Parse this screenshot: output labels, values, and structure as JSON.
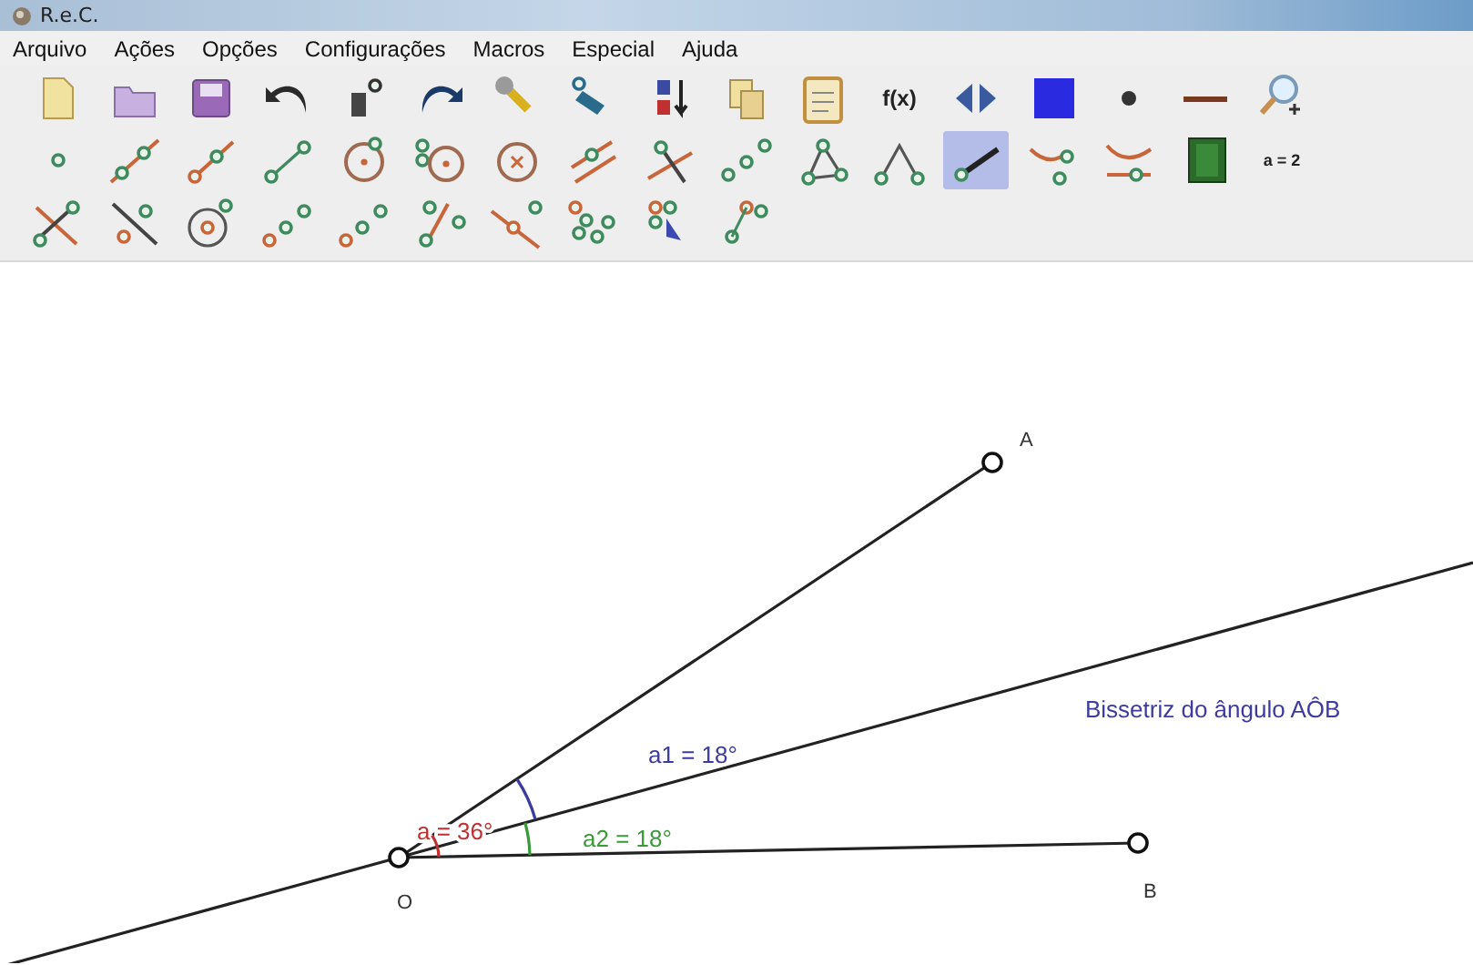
{
  "window": {
    "title": "R.e.C."
  },
  "menu": [
    "Arquivo",
    "Ações",
    "Opções",
    "Configurações",
    "Macros",
    "Especial",
    "Ajuda"
  ],
  "toolbar": {
    "rows": [
      [
        {
          "selected": false
        },
        {
          "selected": false
        },
        {
          "selected": false
        },
        {
          "selected": false
        },
        {
          "selected": false
        },
        {
          "selected": false
        },
        {
          "selected": false
        },
        {
          "selected": false
        },
        {
          "selected": false
        },
        {
          "selected": false
        },
        {
          "selected": false
        },
        {
          "selected": false,
          "label": "f(x)"
        },
        {
          "selected": false
        },
        {
          "selected": false
        },
        {
          "selected": false
        },
        {
          "selected": false
        },
        {
          "selected": false
        }
      ],
      [
        {
          "selected": false
        },
        {
          "selected": false
        },
        {
          "selected": false
        },
        {
          "selected": false
        },
        {
          "selected": false
        },
        {
          "selected": false
        },
        {
          "selected": false
        },
        {
          "selected": false
        },
        {
          "selected": false
        },
        {
          "selected": false
        },
        {
          "selected": false
        },
        {
          "selected": false
        },
        {
          "selected": true
        },
        {
          "selected": false
        },
        {
          "selected": false
        },
        {
          "selected": false
        },
        {
          "selected": false,
          "label": "a = 2"
        }
      ],
      [
        {
          "selected": false
        },
        {
          "selected": false
        },
        {
          "selected": false
        },
        {
          "selected": false
        },
        {
          "selected": false
        },
        {
          "selected": false
        },
        {
          "selected": false
        },
        {
          "selected": false
        },
        {
          "selected": false
        },
        {
          "selected": false
        }
      ]
    ]
  },
  "canvas": {
    "points": [
      {
        "label": "A"
      },
      {
        "label": "O"
      },
      {
        "label": "B"
      }
    ],
    "angles": [
      {
        "text": "a1 = 18°",
        "color": "#3c3ca0"
      },
      {
        "text": "a2 = 18°",
        "color": "#3a9a3a"
      },
      {
        "text": "a = 36°",
        "color": "#c03030"
      }
    ],
    "caption": "Bissetriz do ângulo AÔB"
  }
}
